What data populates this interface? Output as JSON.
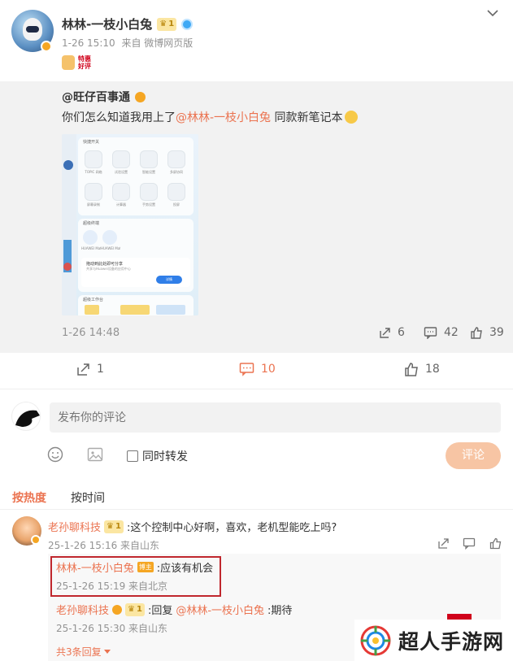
{
  "post": {
    "author": "林林-一枝小白兔",
    "level": "1",
    "meta_time": "1-26 15:10",
    "meta_source": "来自 微博网页版",
    "badge_text_line1": "特惠",
    "badge_text_line2": "好评"
  },
  "repost": {
    "mention": "@旺仔百事通",
    "text_before": "你们怎么知道我用上了",
    "text_mention": "@林林-一枝小白兔",
    "text_after": " 同款新笔记本",
    "time": "1-26 14:48",
    "share_count": "6",
    "comment_count": "42",
    "like_count": "39",
    "panel": {
      "section1": "快捷开关",
      "tiles": [
        "TOPIC 网络",
        "试验设置",
        "智能设置",
        "多屏协同",
        "屏幕录制",
        "计算器",
        "手势设置",
        "投屏"
      ],
      "section2": "超级终端",
      "devices": [
        "HUAWEI MateBook",
        "HUAWEI Mate"
      ],
      "card_title": "拖动到此处即可分享",
      "card_sub": "共享与Huawei设备的应用中心",
      "card_button": "详情",
      "section3": "超级工作台"
    }
  },
  "actions": {
    "share": "1",
    "comment": "10",
    "like": "18"
  },
  "compose": {
    "placeholder": "发布你的评论",
    "repost_checkbox": "同时转发",
    "submit": "评论"
  },
  "sort": {
    "hot": "按热度",
    "time": "按时间"
  },
  "comment": {
    "author": "老孙聊科技",
    "level": "1",
    "text": ":这个控制中心好啊，喜欢，老机型能吃上吗?",
    "meta": "25-1-26 15:16 来自山东",
    "replies": [
      {
        "author": "林林-一枝小白兔",
        "tag": "博主",
        "text": ":应该有机会",
        "meta": "25-1-26 15:19 来自北京"
      },
      {
        "author": "老孙聊科技",
        "level": "1",
        "prefix": ":回复",
        "mention": "@林林-一枝小白兔",
        "text": ":期待",
        "meta": "25-1-26 15:30 来自山东"
      }
    ],
    "more": "共3条回复"
  },
  "watermark": {
    "text": "超人手游网"
  },
  "colors": {
    "accent": "#eb7350",
    "grey_bg": "#f2f2f2",
    "highlight": "#c0272d"
  }
}
